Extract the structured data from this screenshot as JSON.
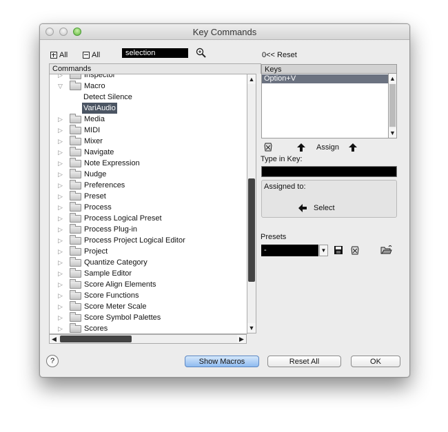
{
  "window": {
    "title": "Key Commands"
  },
  "toolbar": {
    "expand_all_label": "All",
    "collapse_all_label": "All",
    "search_value": "selection"
  },
  "commands": {
    "header": "Commands",
    "items": [
      {
        "label": "Inspector",
        "level": 0,
        "expanded": false
      },
      {
        "label": "Macro",
        "level": 0,
        "expanded": true
      },
      {
        "label": "Detect Silence",
        "level": 1
      },
      {
        "label": "VariAudio",
        "level": 1,
        "selected": true
      },
      {
        "label": "Media",
        "level": 0,
        "expanded": false
      },
      {
        "label": "MIDI",
        "level": 0,
        "expanded": false
      },
      {
        "label": "Mixer",
        "level": 0,
        "expanded": false
      },
      {
        "label": "Navigate",
        "level": 0,
        "expanded": false
      },
      {
        "label": "Note Expression",
        "level": 0,
        "expanded": false
      },
      {
        "label": "Nudge",
        "level": 0,
        "expanded": false
      },
      {
        "label": "Preferences",
        "level": 0,
        "expanded": false
      },
      {
        "label": "Preset",
        "level": 0,
        "expanded": false
      },
      {
        "label": "Process",
        "level": 0,
        "expanded": false
      },
      {
        "label": "Process Logical Preset",
        "level": 0,
        "expanded": false
      },
      {
        "label": "Process Plug-in",
        "level": 0,
        "expanded": false
      },
      {
        "label": "Process Project Logical Editor",
        "level": 0,
        "expanded": false
      },
      {
        "label": "Project",
        "level": 0,
        "expanded": false
      },
      {
        "label": "Quantize Category",
        "level": 0,
        "expanded": false
      },
      {
        "label": "Sample Editor",
        "level": 0,
        "expanded": false
      },
      {
        "label": "Score Align Elements",
        "level": 0,
        "expanded": false
      },
      {
        "label": "Score Functions",
        "level": 0,
        "expanded": false
      },
      {
        "label": "Score Meter Scale",
        "level": 0,
        "expanded": false
      },
      {
        "label": "Score Symbol Palettes",
        "level": 0,
        "expanded": false
      },
      {
        "label": "Scores",
        "level": 0,
        "expanded": false
      }
    ]
  },
  "keys_panel": {
    "reset_label": "Reset",
    "reset_glyph": "0<<",
    "header": "Keys",
    "keys": [
      "Option+V"
    ],
    "assign_label": "Assign",
    "type_in_key_label": "Type in Key:",
    "type_in_key_value": "",
    "assigned_to_label": "Assigned to:",
    "select_label": "Select"
  },
  "presets": {
    "label": "Presets",
    "value": "-"
  },
  "footer": {
    "help_label": "?",
    "show_macros_label": "Show Macros",
    "reset_all_label": "Reset All",
    "ok_label": "OK"
  },
  "colors": {
    "selection": "#4b5563",
    "key_selection": "#6b7280",
    "default_button": "#8fbaf0"
  }
}
